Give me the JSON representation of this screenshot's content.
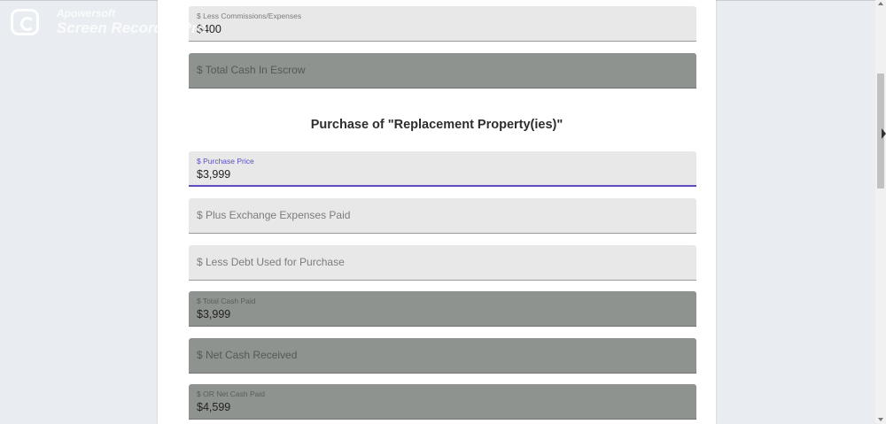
{
  "watermark": {
    "line1": "Apowersoft",
    "line2": "Screen Recorder Pro"
  },
  "fields": {
    "less_commissions": {
      "label": "$ Less Commissions/Expenses",
      "value": "$400"
    },
    "total_cash_in_escrow": {
      "placeholder": "$ Total Cash In Escrow"
    },
    "purchase_price": {
      "label": "$ Purchase Price",
      "value": "$3,999"
    },
    "plus_exchange_expenses": {
      "placeholder": "$ Plus Exchange Expenses Paid"
    },
    "less_debt_used": {
      "placeholder": "$ Less Debt Used for Purchase"
    },
    "total_cash_paid": {
      "label": "$ Total Cash Paid",
      "value": "$3,999"
    },
    "net_cash_received": {
      "placeholder": "$ Net Cash Received"
    },
    "or_net_cash_paid": {
      "label": "$ OR Net Cash Paid",
      "value": "$4,599"
    }
  },
  "section": {
    "title": "Purchase of \"Replacement Property(ies)\""
  },
  "colors": {
    "page_background": "#e9edf1",
    "card_background": "#ffffff",
    "input_background": "#e8e8e8",
    "readonly_background": "#8f938f",
    "focus_accent": "#5d4bc4"
  }
}
